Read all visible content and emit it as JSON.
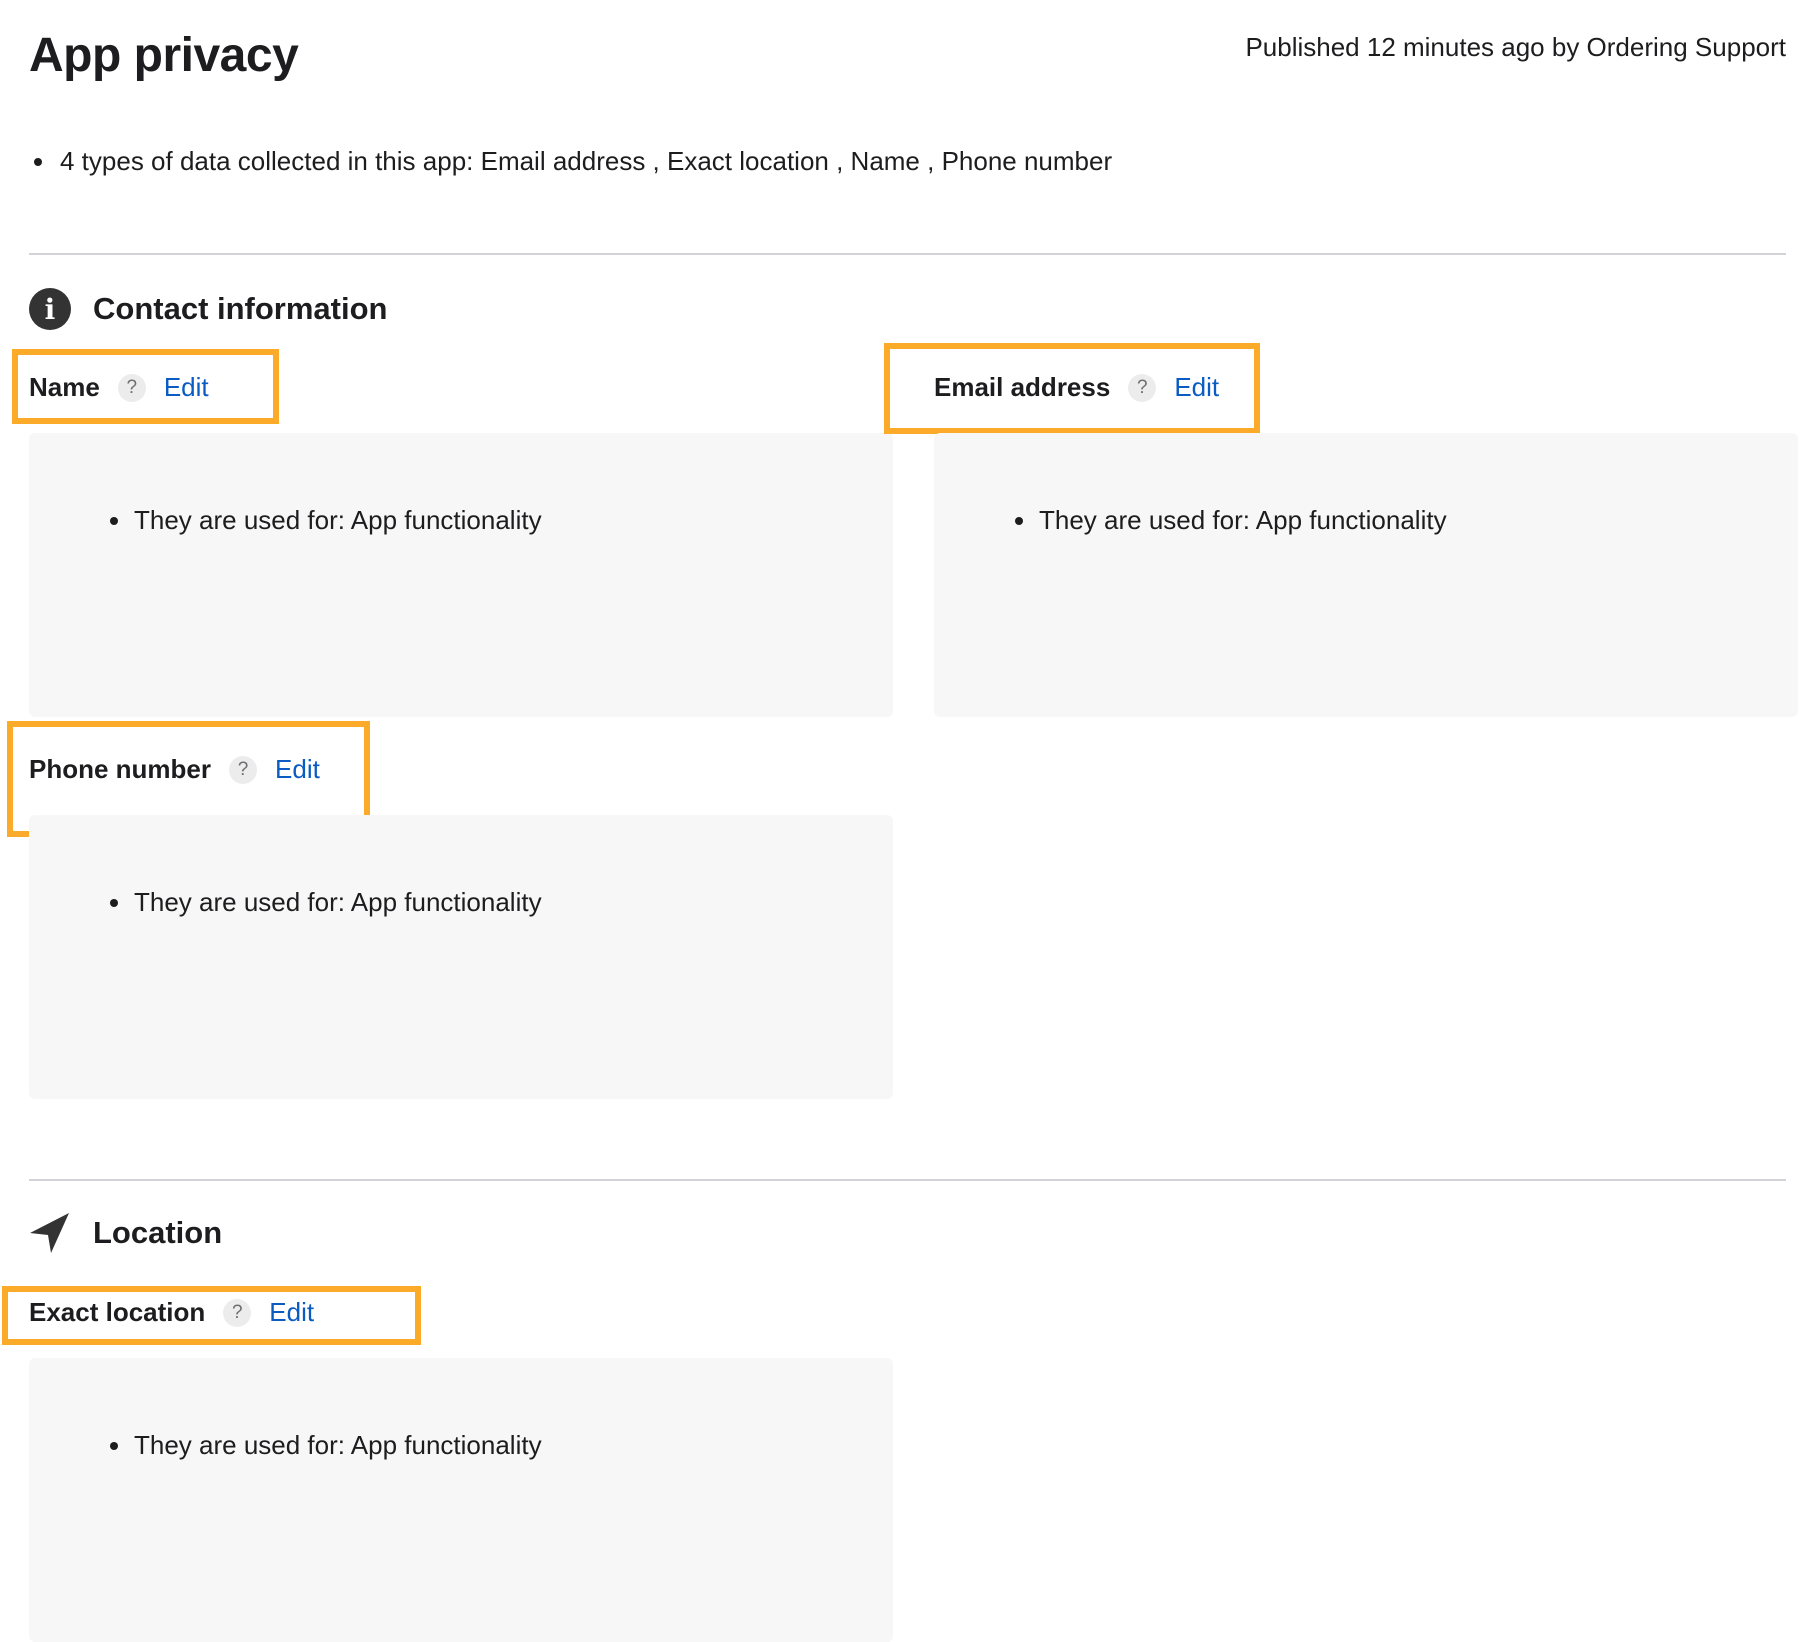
{
  "header": {
    "title": "App privacy",
    "published": "Published 12 minutes ago by Ordering Support"
  },
  "summary": "4 types of data collected in this app: Email address , Exact location , Name , Phone number",
  "sections": {
    "contact": {
      "title": "Contact information",
      "icon": "info-icon",
      "items": {
        "name": {
          "label": "Name",
          "help": "?",
          "edit": "Edit",
          "usage": "They are used for: App functionality"
        },
        "email": {
          "label": "Email address",
          "help": "?",
          "edit": "Edit",
          "usage": "They are used for: App functionality"
        },
        "phone": {
          "label": "Phone number",
          "help": "?",
          "edit": "Edit",
          "usage": "They are used for: App functionality"
        }
      }
    },
    "location": {
      "title": "Location",
      "icon": "location-arrow-icon",
      "items": {
        "exact": {
          "label": "Exact location",
          "help": "?",
          "edit": "Edit",
          "usage": "They are used for: App functionality"
        }
      }
    }
  },
  "colors": {
    "highlight": "#fbaa2a",
    "link": "#0a5cc2",
    "card": "#f7f7f7"
  }
}
